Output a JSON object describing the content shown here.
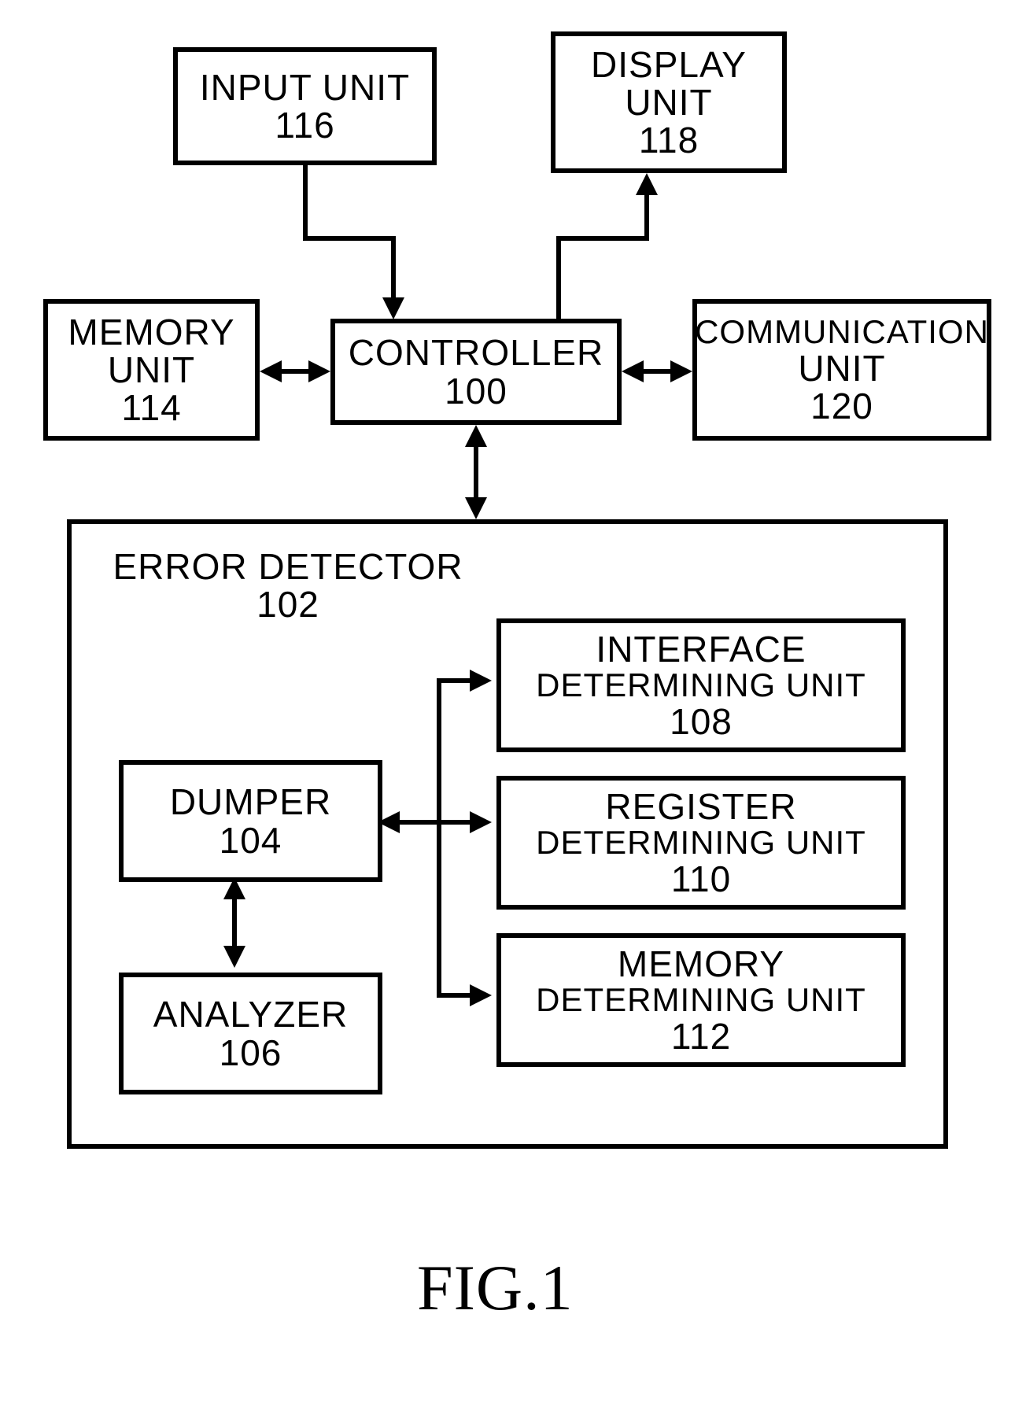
{
  "diagram": {
    "input_unit": {
      "label": "INPUT UNIT",
      "ref": "116"
    },
    "display_unit": {
      "label1": "DISPLAY",
      "label2": "UNIT",
      "ref": "118"
    },
    "memory_unit": {
      "label1": "MEMORY",
      "label2": "UNIT",
      "ref": "114"
    },
    "controller": {
      "label": "CONTROLLER",
      "ref": "100"
    },
    "communication_unit": {
      "label1": "COMMUNICATION",
      "label2": "UNIT",
      "ref": "120"
    },
    "error_detector": {
      "label": "ERROR DETECTOR",
      "ref": "102"
    },
    "dumper": {
      "label": "DUMPER",
      "ref": "104"
    },
    "analyzer": {
      "label": "ANALYZER",
      "ref": "106"
    },
    "interface_det": {
      "label1": "INTERFACE",
      "label2": "DETERMINING UNIT",
      "ref": "108"
    },
    "register_det": {
      "label1": "REGISTER",
      "label2": "DETERMINING UNIT",
      "ref": "110"
    },
    "memory_det": {
      "label1": "MEMORY",
      "label2": "DETERMINING UNIT",
      "ref": "112"
    }
  },
  "figure_caption": "FIG.1"
}
